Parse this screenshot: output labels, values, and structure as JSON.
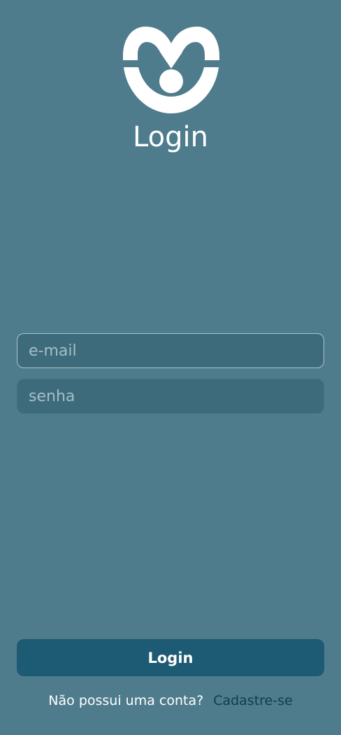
{
  "header": {
    "logo_icon": "heart-person-icon",
    "title": "Login"
  },
  "form": {
    "email_placeholder": "e-mail",
    "email_value": "",
    "password_placeholder": "senha",
    "password_value": ""
  },
  "actions": {
    "login_label": "Login"
  },
  "footer": {
    "question": "Não possui uma conta?",
    "signup_label": "Cadastre-se"
  },
  "colors": {
    "background": "#4f7c8c",
    "field_background": "#3e6b7c",
    "button_background": "#1d5a73",
    "link": "#0f3b4f"
  }
}
